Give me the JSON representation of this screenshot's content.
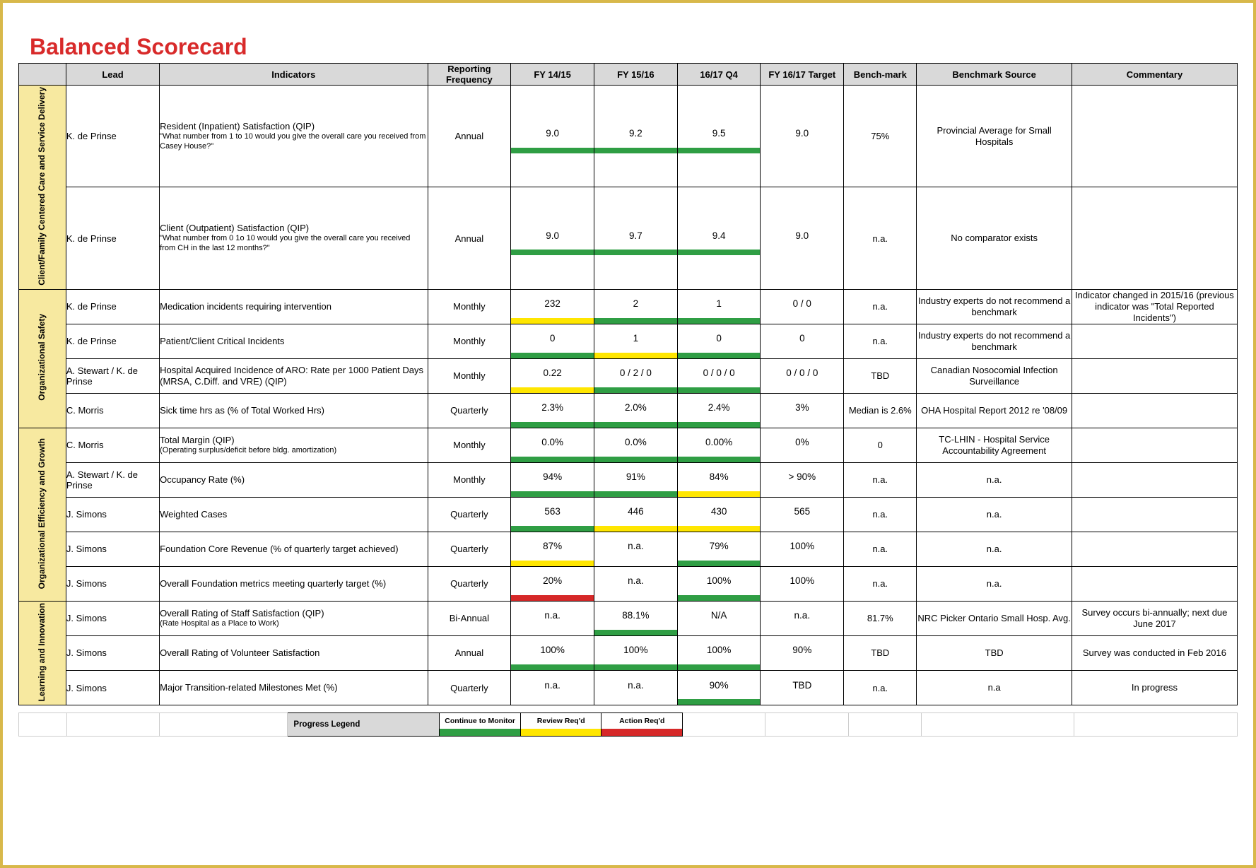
{
  "title": "Balanced Scorecard",
  "columns": {
    "lead": "Lead",
    "indicators": "Indicators",
    "freq": "Reporting Frequency",
    "m1": "FY 14/15",
    "m2": "FY 15/16",
    "m3": "16/17 Q4",
    "m4": "FY 16/17 Target",
    "bench": "Bench-mark",
    "src": "Benchmark Source",
    "comm": "Commentary"
  },
  "categories": [
    {
      "name": "Client/Family Centered Care and Service Delivery",
      "rows": [
        {
          "lead": "K. de Prinse",
          "indicator": "Resident (Inpatient) Satisfaction (QIP)",
          "indicator_sub": "\"What number from 1 to 10 would you give the overall care you received from Casey House?\"",
          "freq": "Annual",
          "m": [
            {
              "v": "9.0",
              "bar": "green"
            },
            {
              "v": "9.2",
              "bar": "green"
            },
            {
              "v": "9.5",
              "bar": "green"
            },
            {
              "v": "9.0",
              "bar": "none"
            }
          ],
          "bench": "75%",
          "src": "Provincial Average for Small Hospitals",
          "comm": ""
        },
        {
          "lead": "K. de Prinse",
          "indicator": "Client (Outpatient) Satisfaction (QIP)",
          "indicator_sub": "\"What number from 0 1o 10 would you give the overall care you received from CH in the last 12 months?\"",
          "freq": "Annual",
          "m": [
            {
              "v": "9.0",
              "bar": "green"
            },
            {
              "v": "9.7",
              "bar": "green"
            },
            {
              "v": "9.4",
              "bar": "green"
            },
            {
              "v": "9.0",
              "bar": "none"
            }
          ],
          "bench": "n.a.",
          "src": "No comparator exists",
          "comm": ""
        }
      ]
    },
    {
      "name": "Organizational Safety",
      "rows": [
        {
          "lead": "K. de Prinse",
          "indicator": "Medication incidents requiring intervention",
          "indicator_sub": "",
          "freq": "Monthly",
          "m": [
            {
              "v": "232",
              "bar": "yellow"
            },
            {
              "v": "2",
              "bar": "green"
            },
            {
              "v": "1",
              "bar": "green"
            },
            {
              "v": "0 / 0",
              "bar": "none"
            }
          ],
          "bench": "n.a.",
          "src": "Industry experts do not recommend a benchmark",
          "comm": "Indicator changed in 2015/16 (previous indicator was \"Total Reported Incidents\")"
        },
        {
          "lead": "K. de Prinse",
          "indicator": "Patient/Client Critical Incidents",
          "indicator_sub": "",
          "freq": "Monthly",
          "m": [
            {
              "v": "0",
              "bar": "green"
            },
            {
              "v": "1",
              "bar": "yellow"
            },
            {
              "v": "0",
              "bar": "green"
            },
            {
              "v": "0",
              "bar": "none"
            }
          ],
          "bench": "n.a.",
          "src": "Industry experts do not recommend a benchmark",
          "comm": ""
        },
        {
          "lead": "A. Stewart / K. de Prinse",
          "indicator": "Hospital Acquired Incidence of ARO: Rate per 1000 Patient Days (MRSA, C.Diff. and VRE) (QIP)",
          "indicator_sub": "",
          "freq": "Monthly",
          "m": [
            {
              "v": "0.22",
              "bar": "yellow"
            },
            {
              "v": "0 / 2 / 0",
              "bar": "green"
            },
            {
              "v": "0 / 0 / 0",
              "bar": "green"
            },
            {
              "v": "0 / 0 / 0",
              "bar": "none"
            }
          ],
          "bench": "TBD",
          "src": "Canadian Nosocomial Infection Surveillance",
          "comm": ""
        },
        {
          "lead": "C. Morris",
          "indicator": "Sick time hrs as (% of Total Worked Hrs)",
          "indicator_sub": "",
          "freq": "Quarterly",
          "m": [
            {
              "v": "2.3%",
              "bar": "green"
            },
            {
              "v": "2.0%",
              "bar": "green"
            },
            {
              "v": "2.4%",
              "bar": "green"
            },
            {
              "v": "3%",
              "bar": "none"
            }
          ],
          "bench": "Median is 2.6%",
          "src": "OHA Hospital Report 2012 re '08/09",
          "comm": ""
        }
      ]
    },
    {
      "name": "Organizational Efficiency and Growth",
      "rows": [
        {
          "lead": "C. Morris",
          "indicator": "Total Margin (QIP)",
          "indicator_sub": "(Operating surplus/deficit before bldg. amortization)",
          "freq": "Monthly",
          "m": [
            {
              "v": "0.0%",
              "bar": "green"
            },
            {
              "v": "0.0%",
              "bar": "green"
            },
            {
              "v": "0.00%",
              "bar": "green"
            },
            {
              "v": "0%",
              "bar": "none"
            }
          ],
          "bench": "0",
          "src": "TC-LHIN - Hospital Service Accountability Agreement",
          "comm": ""
        },
        {
          "lead": "A. Stewart / K. de Prinse",
          "indicator": "Occupancy Rate (%)",
          "indicator_sub": "",
          "freq": "Monthly",
          "m": [
            {
              "v": "94%",
              "bar": "green"
            },
            {
              "v": "91%",
              "bar": "green"
            },
            {
              "v": "84%",
              "bar": "yellow"
            },
            {
              "v": "> 90%",
              "bar": "none"
            }
          ],
          "bench": "n.a.",
          "src": "n.a.",
          "comm": ""
        },
        {
          "lead": "J. Simons",
          "indicator": "Weighted Cases",
          "indicator_sub": "",
          "freq": "Quarterly",
          "m": [
            {
              "v": "563",
              "bar": "green"
            },
            {
              "v": "446",
              "bar": "yellow"
            },
            {
              "v": "430",
              "bar": "yellow"
            },
            {
              "v": "565",
              "bar": "none"
            }
          ],
          "bench": "n.a.",
          "src": "n.a.",
          "comm": ""
        },
        {
          "lead": "J. Simons",
          "indicator": "Foundation Core Revenue (% of quarterly target achieved)",
          "indicator_sub": "",
          "freq": "Quarterly",
          "m": [
            {
              "v": "87%",
              "bar": "yellow"
            },
            {
              "v": "n.a.",
              "bar": "none"
            },
            {
              "v": "79%",
              "bar": "green"
            },
            {
              "v": "100%",
              "bar": "none"
            }
          ],
          "bench": "n.a.",
          "src": "n.a.",
          "comm": ""
        },
        {
          "lead": "J. Simons",
          "indicator": "Overall Foundation metrics meeting quarterly target (%)",
          "indicator_sub": "",
          "freq": "Quarterly",
          "m": [
            {
              "v": "20%",
              "bar": "red"
            },
            {
              "v": "n.a.",
              "bar": "none"
            },
            {
              "v": "100%",
              "bar": "green"
            },
            {
              "v": "100%",
              "bar": "none"
            }
          ],
          "bench": "n.a.",
          "src": "n.a.",
          "comm": ""
        }
      ]
    },
    {
      "name": "Learning and Innovation",
      "rows": [
        {
          "lead": "J. Simons",
          "indicator": "Overall Rating of Staff Satisfaction (QIP)",
          "indicator_sub": "(Rate Hospital as a Place to Work)",
          "freq": "Bi-Annual",
          "m": [
            {
              "v": "n.a.",
              "bar": "none"
            },
            {
              "v": "88.1%",
              "bar": "green"
            },
            {
              "v": "N/A",
              "bar": "none"
            },
            {
              "v": "n.a.",
              "bar": "none"
            }
          ],
          "bench": "81.7%",
          "src": "NRC Picker\nOntario Small Hosp. Avg.",
          "comm": "Survey occurs bi-annually; next due June 2017"
        },
        {
          "lead": "J. Simons",
          "indicator": "Overall Rating of Volunteer Satisfaction",
          "indicator_sub": "",
          "freq": "Annual",
          "m": [
            {
              "v": "100%",
              "bar": "green"
            },
            {
              "v": "100%",
              "bar": "green"
            },
            {
              "v": "100%",
              "bar": "green"
            },
            {
              "v": "90%",
              "bar": "none"
            }
          ],
          "bench": "TBD",
          "src": "TBD",
          "comm": "Survey was conducted in Feb 2016"
        },
        {
          "lead": "J. Simons",
          "indicator": "Major Transition-related Milestones Met (%)",
          "indicator_sub": "",
          "freq": "Quarterly",
          "m": [
            {
              "v": "n.a.",
              "bar": "none"
            },
            {
              "v": "n.a.",
              "bar": "none"
            },
            {
              "v": "90%",
              "bar": "green"
            },
            {
              "v": "TBD",
              "bar": "none"
            }
          ],
          "bench": "n.a.",
          "src": "n.a",
          "comm": "In progress"
        }
      ]
    }
  ],
  "legend": {
    "label": "Progress Legend",
    "items": [
      {
        "text": "Continue to Monitor",
        "bar": "green"
      },
      {
        "text": "Review Req'd",
        "bar": "yellow"
      },
      {
        "text": "Action Req'd",
        "bar": "red"
      }
    ]
  }
}
